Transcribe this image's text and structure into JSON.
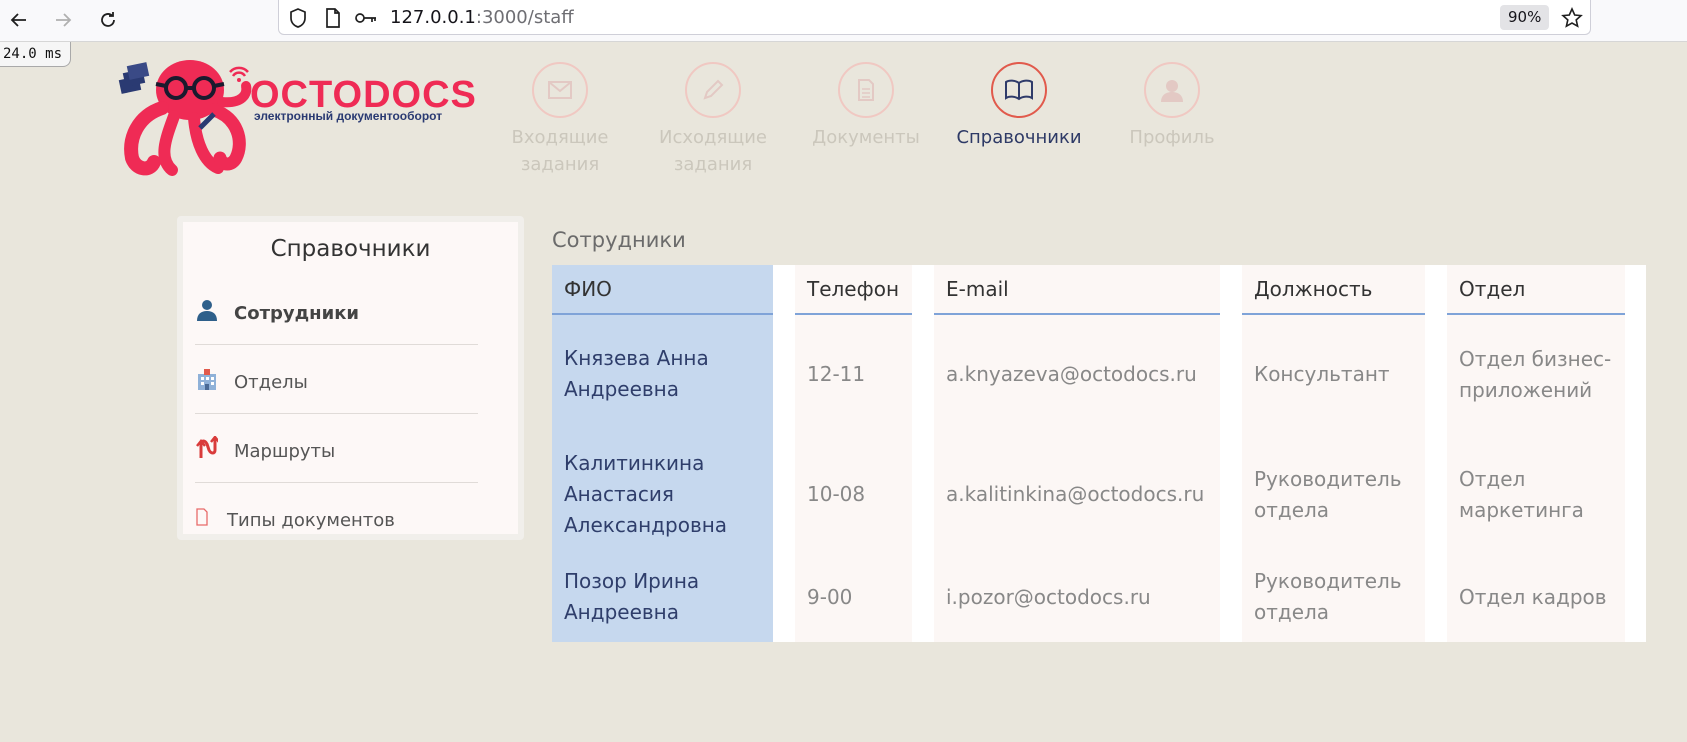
{
  "browser": {
    "url_host": "127.0.0.1",
    "url_path": ":3000/staff",
    "zoom": "90%",
    "timing": "24.0 ms"
  },
  "logo": {
    "brand": "OCTODOCS",
    "tagline": "электронный документооборот",
    "brand_color": "#ef2b55",
    "brand_dark": "#2a3a72"
  },
  "topnav": [
    {
      "label": "Входящие задания",
      "icon": "envelope-icon",
      "active": false
    },
    {
      "label": "Исходящие задания",
      "icon": "pencil-icon",
      "active": false
    },
    {
      "label": "Документы",
      "icon": "document-icon",
      "active": false
    },
    {
      "label": "Справочники",
      "icon": "book-icon",
      "active": true
    },
    {
      "label": "Профиль",
      "icon": "user-icon",
      "active": false
    }
  ],
  "sidebar": {
    "title": "Справочники",
    "items": [
      {
        "label": "Сотрудники",
        "icon": "person-icon",
        "active": true
      },
      {
        "label": "Отделы",
        "icon": "building-icon",
        "active": false
      },
      {
        "label": "Маршруты",
        "icon": "route-arrows-icon",
        "active": false
      },
      {
        "label": "Типы документов",
        "icon": "file-icon",
        "active": false
      }
    ]
  },
  "main": {
    "title": "Сотрудники",
    "columns": [
      "ФИО",
      "Телефон",
      "E-mail",
      "Должность",
      "Отдел"
    ],
    "rows": [
      {
        "fio": "Князева Анна Андреевна",
        "phone": "12-11",
        "email": "a.knyazeva@octodocs.ru",
        "position": "Консультант",
        "department": "Отдел бизнес-приложений"
      },
      {
        "fio": "Калитинкина Анастасия Александровна",
        "phone": "10-08",
        "email": "a.kalitinkina@octodocs.ru",
        "position": "Руководитель отдела",
        "department": "Отдел маркетинга"
      },
      {
        "fio": "Позор Ирина Андреевна",
        "phone": "9-00",
        "email": "i.pozor@octodocs.ru",
        "position": "Руководитель отдела",
        "department": "Отдел кадров"
      }
    ]
  },
  "colors": {
    "page_bg": "#e9e6dc",
    "accent_red": "#e15a4c",
    "fio_column_bg": "#c6d8ee",
    "header_underline": "#7fa3d8"
  }
}
